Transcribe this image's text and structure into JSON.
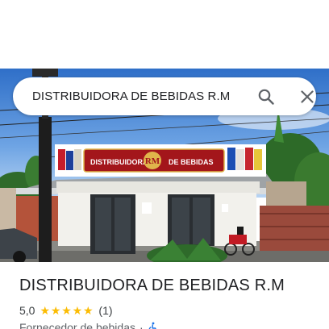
{
  "search": {
    "query": "DISTRIBUIDORA DE BEBIDAS R.M",
    "search_icon": "search-icon",
    "close_icon": "close-icon"
  },
  "photo": {
    "sign_left": "DISTRIBUIDORA",
    "sign_brand": "RM",
    "sign_right": "DE BEBIDAS"
  },
  "place": {
    "name": "DISTRIBUIDORA DE BEBIDAS R.M",
    "rating": "5,0",
    "stars": 5,
    "reviews": "(1)",
    "category": "Fornecedor de bebidas",
    "separator": "·",
    "accessibility_icon": "wheelchair-icon"
  },
  "colors": {
    "star": "#fbbc04",
    "sign_red": "#a3161b",
    "sky": "#3f7fd0"
  }
}
